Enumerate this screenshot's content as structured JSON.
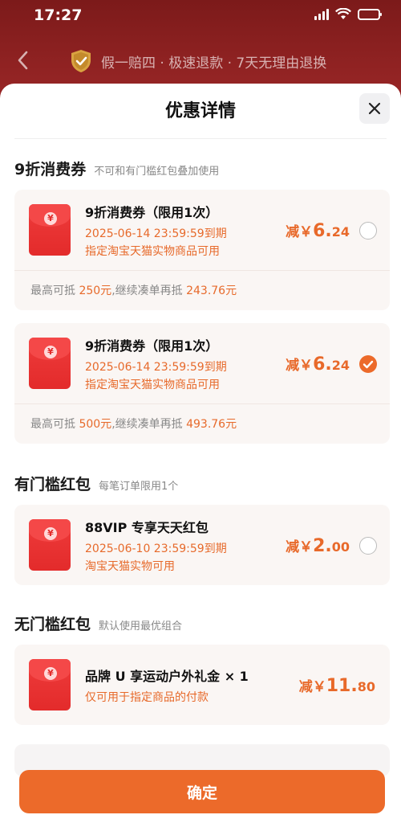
{
  "status": {
    "time": "17:27"
  },
  "nav": {
    "guarantee_text": "假一赔四 · 极速退款 · 7天无理由退换"
  },
  "sheet": {
    "title": "优惠详情"
  },
  "sections": {
    "discount": {
      "title": "9折消费券",
      "note": "不可和有门槛红包叠加使用"
    },
    "threshold": {
      "title": "有门槛红包",
      "note": "每笔订单限用1个"
    },
    "nothreshold": {
      "title": "无门槛红包",
      "note": "默认使用最优组合"
    }
  },
  "coupons": [
    {
      "name": "9折消费券（限用1次）",
      "expire": "2025-06-14 23:59:59到期",
      "scope": "指定淘宝天猫实物商品可用",
      "amount_prefix": "减￥",
      "amount_int": "6.",
      "amount_dec": "24",
      "checked": false,
      "foot_pre": "最高可抵 ",
      "foot_max": "250元",
      "foot_mid": ",继续凑单再抵 ",
      "foot_more": "243.76元"
    },
    {
      "name": "9折消费券（限用1次）",
      "expire": "2025-06-14 23:59:59到期",
      "scope": "指定淘宝天猫实物商品可用",
      "amount_prefix": "减￥",
      "amount_int": "6.",
      "amount_dec": "24",
      "checked": true,
      "foot_pre": "最高可抵 ",
      "foot_max": "500元",
      "foot_mid": ",继续凑单再抵 ",
      "foot_more": "493.76元"
    },
    {
      "name": "88VIP 专享天天红包",
      "expire": "2025-06-10 23:59:59到期",
      "scope": "淘宝天猫实物可用",
      "amount_prefix": "减￥",
      "amount_int": "2.",
      "amount_dec": "00",
      "checked": false
    },
    {
      "name": "品牌 U 享运动户外礼金 × 1",
      "scope": "仅可用于指定商品的付款",
      "amount_prefix": "减￥",
      "amount_int": "11.",
      "amount_dec": "80"
    }
  ],
  "confirm": {
    "label": "确定"
  },
  "colors": {
    "accent": "#ec6a2a",
    "coupon_red": "#e32b2b",
    "header_bg": "#8e1d1d"
  }
}
